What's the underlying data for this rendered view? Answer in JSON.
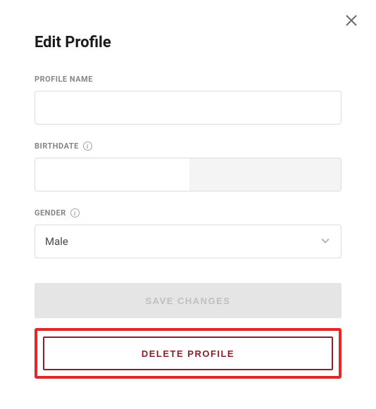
{
  "modal": {
    "title": "Edit Profile"
  },
  "fields": {
    "profile_name": {
      "label": "PROFILE NAME",
      "value": ""
    },
    "birthdate": {
      "label": "BIRTHDATE",
      "value": "",
      "info": "i"
    },
    "gender": {
      "label": "GENDER",
      "value": "Male",
      "info": "i"
    }
  },
  "buttons": {
    "save": "SAVE CHANGES",
    "delete": "DELETE PROFILE"
  }
}
